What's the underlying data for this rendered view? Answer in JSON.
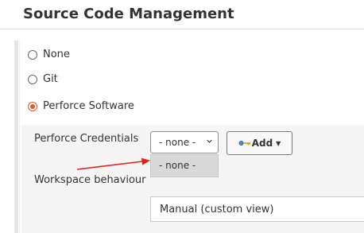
{
  "section": {
    "title": "Source Code Management"
  },
  "scm_options": [
    {
      "label": "None",
      "checked": false
    },
    {
      "label": "Git",
      "checked": false
    },
    {
      "label": "Perforce Software",
      "checked": true
    }
  ],
  "perforce": {
    "credentials_label": "Perforce Credentials",
    "credentials_selected": "- none -",
    "credentials_options": [
      "- none -"
    ],
    "add_button_label": "Add",
    "workspace_label": "Workspace behaviour",
    "workspace_selected": "Manual (custom view)"
  },
  "colors": {
    "radio_accent": "#e05a24",
    "annotation_arrow": "#e8201f"
  },
  "icons": {
    "add_key": "key-icon",
    "add_caret": "caret-down-icon",
    "select_chevron": "chevron-down-icon",
    "annotation": "arrow-icon"
  }
}
